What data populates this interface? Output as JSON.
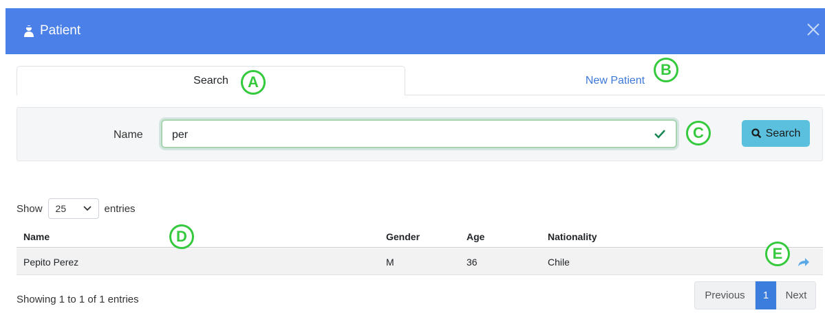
{
  "modal": {
    "title": "Patient",
    "close_icon": "close-icon",
    "title_icon": "user-injured-icon",
    "header_color": "#4a80e8"
  },
  "tabs": [
    {
      "label": "Search",
      "active": true
    },
    {
      "label": "New Patient",
      "active": false
    }
  ],
  "search_form": {
    "name_label": "Name",
    "name_value": "per",
    "button_label": "Search",
    "valid_icon": "check-icon",
    "button_icon": "search-icon",
    "button_color": "#5bc0de"
  },
  "table_controls": {
    "show_label": "Show",
    "entries_value": "25",
    "entries_label": "entries"
  },
  "table": {
    "columns": [
      "Name",
      "Gender",
      "Age",
      "Nationality"
    ],
    "rows": [
      {
        "name": "Pepito Perez",
        "gender": "M",
        "age": "36",
        "nationality": "Chile",
        "action_icon": "share-arrow-icon"
      }
    ]
  },
  "info": "Showing 1 to 1 of 1 entries",
  "pagination": {
    "previous": "Previous",
    "current": "1",
    "next": "Next",
    "active_color": "#3b7ddd"
  },
  "callouts": [
    "A",
    "B",
    "C",
    "D",
    "E"
  ],
  "callout_color": "#35c93d"
}
